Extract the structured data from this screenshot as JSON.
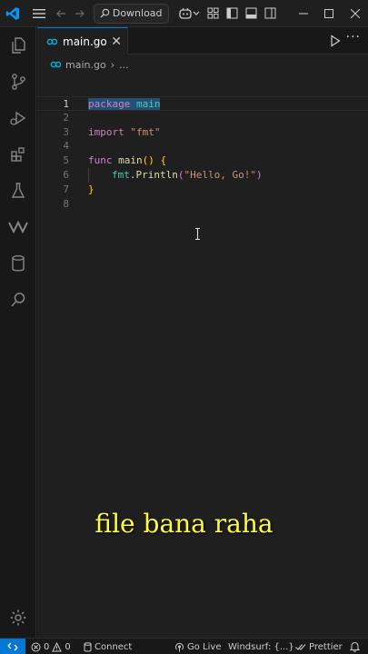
{
  "titlebar": {
    "search_label": "Download"
  },
  "editor": {
    "tab_label": "main.go",
    "breadcrumb_file": "main.go",
    "breadcrumb_more": "...",
    "lines": [
      {
        "n": "1"
      },
      {
        "n": "2"
      },
      {
        "n": "3"
      },
      {
        "n": "4"
      },
      {
        "n": "5"
      },
      {
        "n": "6"
      },
      {
        "n": "7"
      },
      {
        "n": "8"
      }
    ],
    "code": {
      "l1_kw": "package",
      "l1_name": "main",
      "l3_kw": "import",
      "l3_str": "\"fmt\"",
      "l5_kw": "func",
      "l5_fn": "main",
      "l5_rest": "() {",
      "l6_pkg": "fmt",
      "l6_dot": ".",
      "l6_fn": "Println",
      "l6_open": "(",
      "l6_str": "\"Hello, Go!\"",
      "l6_close": ")",
      "l7": "}"
    }
  },
  "overlay": {
    "caption": "file bana raha"
  },
  "statusbar": {
    "errors": "0",
    "warnings": "0",
    "connect": "Connect",
    "golive": "Go Live",
    "windsurf": "Windsurf: {...}",
    "prettier": "Prettier"
  },
  "colors": {
    "accent": "#0078d4",
    "caption": "#ffff33"
  }
}
